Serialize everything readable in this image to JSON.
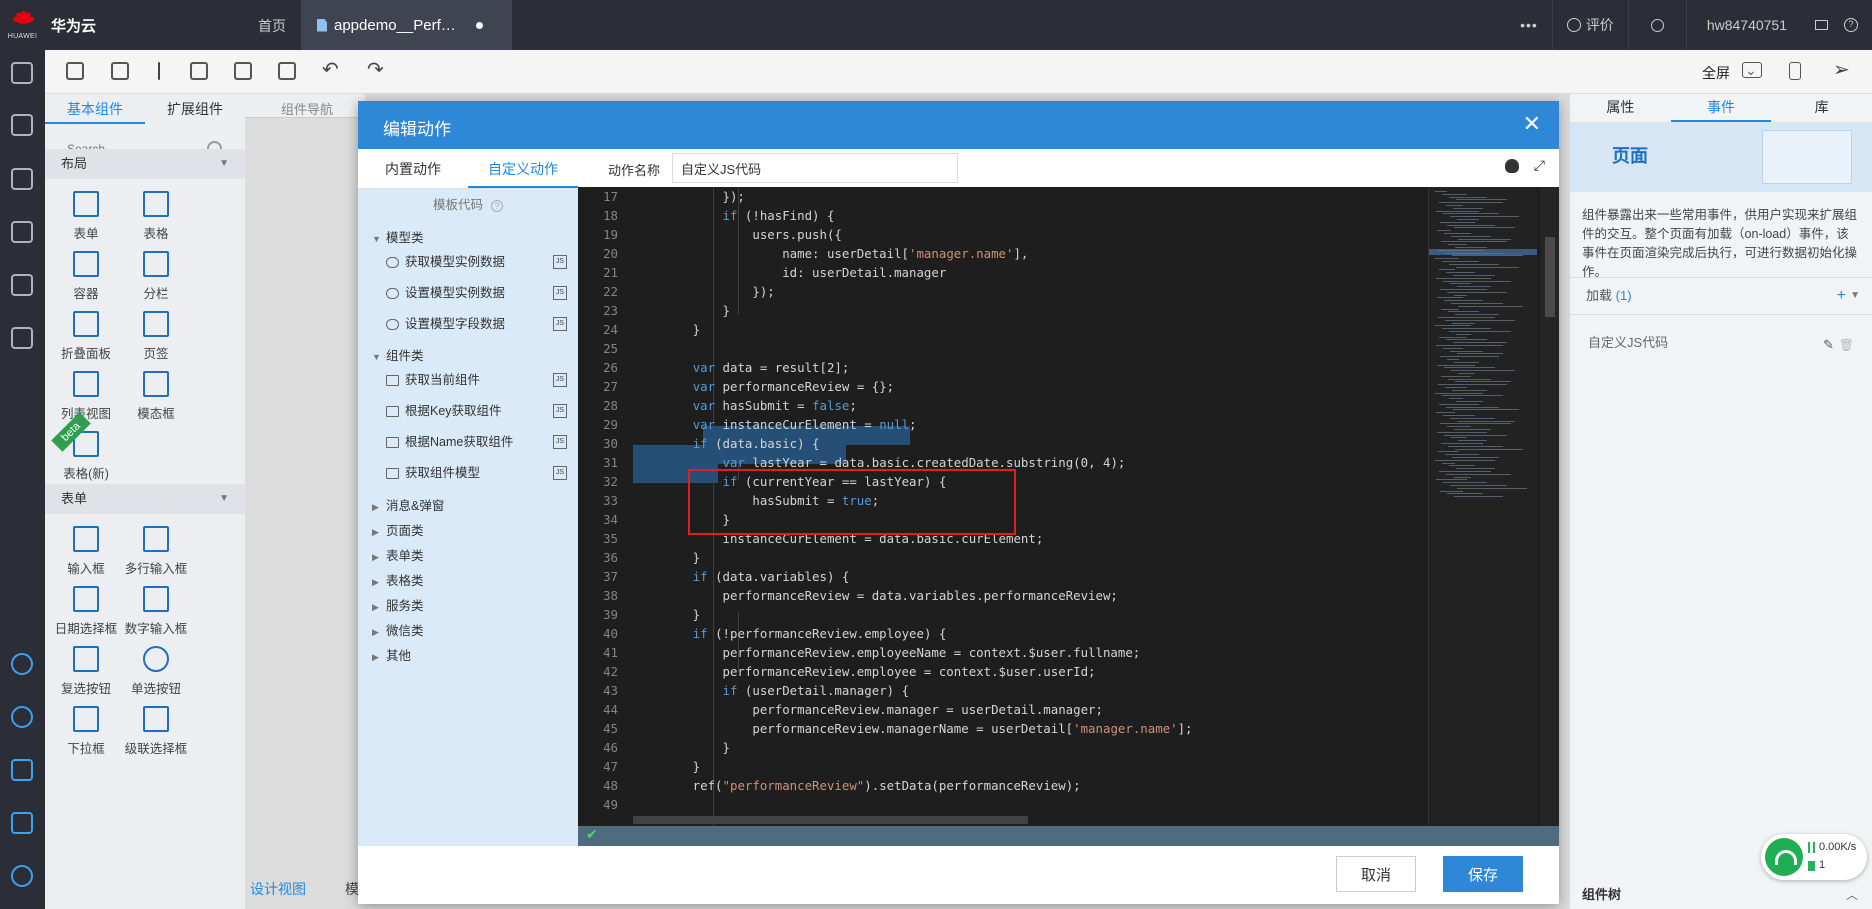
{
  "topbar": {
    "logo_text": "HUAWEI",
    "brand": "华为云",
    "home": "首页",
    "file_tab": "appdemo__Perf…",
    "more": "•••",
    "feedback": "评价",
    "username": "hw84740751"
  },
  "toolbar": {
    "fullscreen": "全屏"
  },
  "components": {
    "tabs": [
      "基本组件",
      "扩展组件"
    ],
    "search_placeholder": "Search",
    "breadcrumb": "组件导航",
    "layout_section": "布局",
    "layout_items": [
      "表单",
      "表格",
      "容器",
      "分栏",
      "折叠面板",
      "页签",
      "列表视图",
      "模态框",
      "表格(新)"
    ],
    "beta": "beta",
    "form_section": "表单",
    "form_items": [
      "输入框",
      "多行输入框",
      "日期选择框",
      "数字输入框",
      "复选按钮",
      "单选按钮",
      "下拉框",
      "级联选择框"
    ]
  },
  "canvas": {
    "design_view": "设计视图",
    "other_view": "模"
  },
  "properties": {
    "tabs": [
      "属性",
      "事件",
      "库"
    ],
    "page_title": "页面",
    "description": "组件暴露出来一些常用事件，供用户实现来扩展组件的交互。整个页面有加载（on-load）事件，该事件在页面渲染完成后执行，可进行数据初始化操作。",
    "load_label": "加载",
    "load_count": "(1)",
    "action_name": "自定义JS代码",
    "tree_title": "组件树"
  },
  "modal": {
    "title": "编辑动作",
    "left_tabs": [
      "内置动作",
      "自定义动作"
    ],
    "template_title": "模板代码",
    "groups": [
      {
        "name": "模型类",
        "items": [
          "获取模型实例数据",
          "设置模型实例数据",
          "设置模型字段数据"
        ]
      },
      {
        "name": "组件类",
        "items": [
          "获取当前组件",
          "根据Key获取组件",
          "根据Name获取组件",
          "获取组件模型"
        ]
      }
    ],
    "collapsed_groups": [
      "消息&弹窗",
      "页面类",
      "表单类",
      "表格类",
      "服务类",
      "微信类",
      "其他"
    ],
    "js_badge": "JS",
    "action_name_label": "动作名称",
    "action_name_value": "自定义JS代码",
    "cancel": "取消",
    "save": "保存"
  },
  "code": {
    "line_numbers": [
      "17",
      "18",
      "19",
      "20",
      "21",
      "22",
      "23",
      "24",
      "25",
      "26",
      "27",
      "28",
      "29",
      "30",
      "31",
      "32",
      "33",
      "34",
      "35",
      "36",
      "37",
      "38",
      "39",
      "40",
      "41",
      "42",
      "43",
      "44",
      "45",
      "46",
      "47",
      "48",
      "49"
    ]
  },
  "network": {
    "speed": "0.00K/s",
    "count": "1"
  }
}
